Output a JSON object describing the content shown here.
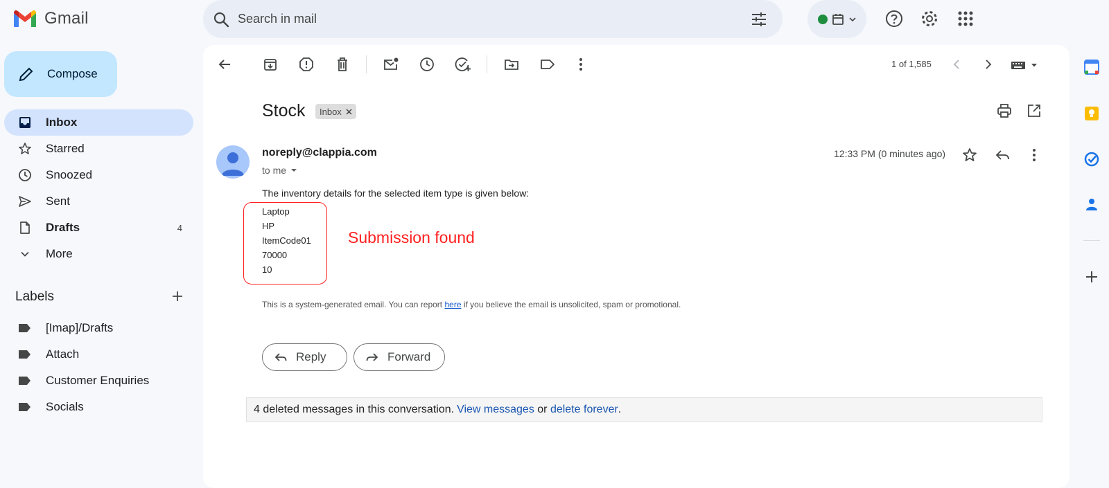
{
  "app": {
    "name": "Gmail"
  },
  "search": {
    "placeholder": "Search in mail"
  },
  "compose": {
    "label": "Compose"
  },
  "sidebar": {
    "items": [
      {
        "label": "Inbox",
        "count": "",
        "icon": "inbox-icon",
        "active": true
      },
      {
        "label": "Starred",
        "count": "",
        "icon": "star-icon"
      },
      {
        "label": "Snoozed",
        "count": "",
        "icon": "clock-icon"
      },
      {
        "label": "Sent",
        "count": "",
        "icon": "send-icon"
      },
      {
        "label": "Drafts",
        "count": "4",
        "icon": "draft-icon"
      },
      {
        "label": "More",
        "count": "",
        "icon": "chevron-down-icon"
      }
    ],
    "labels_heading": "Labels",
    "labels": [
      "[Imap]/Drafts",
      "Attach",
      "Customer Enquiries",
      "Socials"
    ]
  },
  "toolbar": {
    "pager": "1 of 1,585"
  },
  "email": {
    "subject": "Stock",
    "chip": "Inbox",
    "sender": "noreply@clappia.com",
    "to": "to me",
    "time": "12:33 PM (0 minutes ago)",
    "intro": "The inventory details for the selected item type is given below:",
    "items": [
      "Laptop",
      "HP",
      "ItemCode01",
      "70000",
      "10"
    ],
    "annotation": "Submission found",
    "system_note_pre": "This is a system-generated email. You can report ",
    "system_note_link": "here",
    "system_note_post": " if you believe the email is unsolicited, spam or promotional.",
    "reply_label": "Reply",
    "forward_label": "Forward"
  },
  "deleted": {
    "text": "4 deleted messages in this conversation. ",
    "view_link": "View messages",
    "or": " or ",
    "delete_link": "delete forever",
    "end": "."
  },
  "colors": {
    "accent_blue": "#0b57d0",
    "compose_bg": "#c2e7ff",
    "active_nav": "#d3e3fd",
    "annotation_red": "#ff1f1f",
    "status_green": "#1e8e3e"
  }
}
